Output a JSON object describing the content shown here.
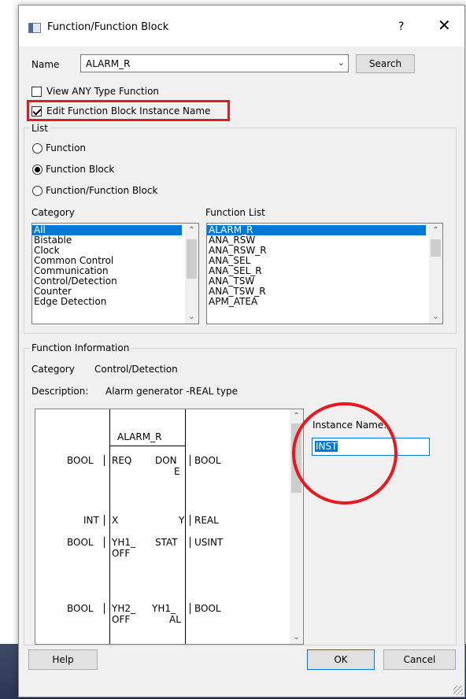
{
  "dialog": {
    "title": "Function/Function Block",
    "help_glyph": "?",
    "close_glyph": "✕"
  },
  "name_row": {
    "label": "Name",
    "value": "ALARM_R",
    "search_label": "Search"
  },
  "options": {
    "view_any_type": {
      "label": "View ANY Type Function",
      "checked": false
    },
    "edit_instance_name": {
      "label": "Edit Function Block Instance Name",
      "checked": true
    }
  },
  "list_group": {
    "title": "List",
    "radios": [
      {
        "label": "Function",
        "selected": false
      },
      {
        "label": "Function Block",
        "selected": true
      },
      {
        "label": "Function/Function Block",
        "selected": false
      }
    ]
  },
  "category": {
    "label": "Category",
    "items": [
      "All",
      "Bistable",
      "Clock",
      "Common Control",
      "Communication",
      "Control/Detection",
      "Counter",
      "Edge Detection"
    ],
    "selected_index": 0
  },
  "function_list": {
    "label": "Function List",
    "items": [
      "ALARM_R",
      "ANA_RSW",
      "ANA_RSW_R",
      "ANA_SEL",
      "ANA_SEL_R",
      "ANA_TSW",
      "ANA_TSW_R",
      "APM_ATEA"
    ],
    "selected_index": 0
  },
  "info": {
    "title": "Function Information",
    "category_label": "Category",
    "category_value": "Control/Detection",
    "description_label": "Description:",
    "description_value": "Alarm generator -REAL type"
  },
  "fb_diagram": {
    "name": "ALARM_R",
    "inputs": [
      {
        "type": "BOOL",
        "pin": "REQ"
      },
      {
        "type": "INT",
        "pin": "X"
      },
      {
        "type": "BOOL",
        "pin_line1": "YH1_",
        "pin_line2": "OFF"
      },
      {
        "type": "BOOL",
        "pin_line1": "YH2_",
        "pin_line2": "OFF"
      }
    ],
    "outputs": [
      {
        "pin_line1": "DON",
        "pin_line2": "E",
        "type": "BOOL"
      },
      {
        "pin": "Y",
        "type": "REAL"
      },
      {
        "pin": "STAT",
        "type": "USINT"
      },
      {
        "pin_line1": "YH1_",
        "pin_line2": "AL",
        "type": "BOOL"
      }
    ]
  },
  "instance": {
    "label": "Instance Name:",
    "value": "INST"
  },
  "footer": {
    "help_label": "Help",
    "ok_label": "OK",
    "cancel_label": "Cancel"
  },
  "colors": {
    "annotation_red": "#e8181e",
    "selection_blue": "#0078d7"
  }
}
